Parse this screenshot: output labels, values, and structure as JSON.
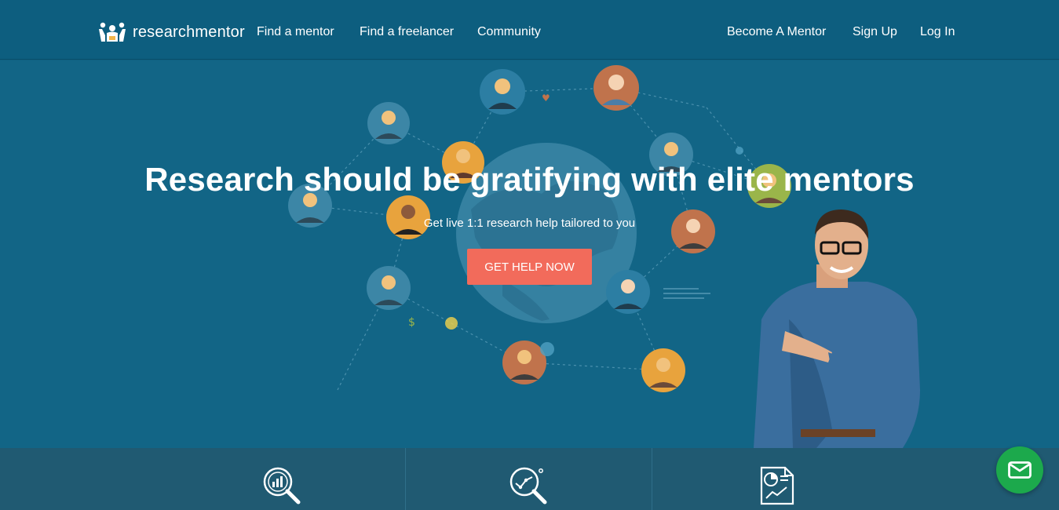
{
  "brand": {
    "name": "researchmentor"
  },
  "nav": {
    "left": [
      "Find a mentor",
      "Find a freelancer",
      "Community"
    ],
    "right": [
      "Become A Mentor",
      "Sign Up",
      "Log In"
    ]
  },
  "hero": {
    "title": "Research should be gratifying with elite mentors",
    "subtitle": "Get live 1:1 research help tailored to you",
    "cta": "GET HELP NOW"
  },
  "features": [
    {
      "icon": "magnifier-chart-icon"
    },
    {
      "icon": "magnifier-trend-icon"
    },
    {
      "icon": "report-document-icon"
    }
  ],
  "colors": {
    "nav_bg": "#0d5e7f",
    "hero_bg": "#126586",
    "cta": "#f26b5b",
    "strip_bg": "#205a72",
    "mail_fab": "#1ca94c"
  },
  "icons": [
    "logo-people-icon",
    "mail-icon"
  ]
}
